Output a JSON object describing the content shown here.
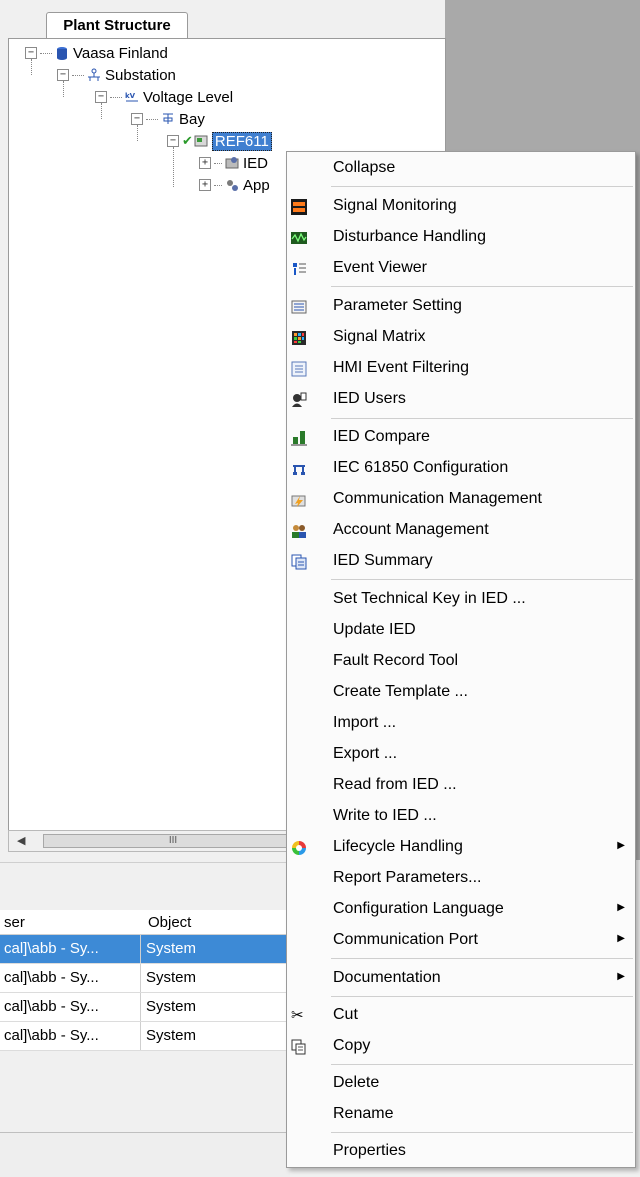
{
  "tab": {
    "title": "Plant Structure"
  },
  "tree": {
    "root": "Vaasa Finland",
    "substation": "Substation",
    "voltage_level": "Voltage Level",
    "bay": "Bay",
    "ied": "REF611",
    "child_ied": "IED",
    "child_app": "App"
  },
  "scrollbar": {
    "thumb_grip": "III"
  },
  "grid": {
    "col_user": "ser",
    "col_object": "Object",
    "rows": [
      {
        "user": "cal]\\abb - Sy...",
        "object": "System"
      },
      {
        "user": "cal]\\abb - Sy...",
        "object": "System"
      },
      {
        "user": "cal]\\abb - Sy...",
        "object": "System"
      },
      {
        "user": "cal]\\abb - Sy...",
        "object": "System"
      }
    ]
  },
  "menu": {
    "collapse": "Collapse",
    "signal_monitoring": "Signal Monitoring",
    "disturbance_handling": "Disturbance Handling",
    "event_viewer": "Event Viewer",
    "parameter_setting": "Parameter Setting",
    "signal_matrix": "Signal Matrix",
    "hmi_event_filtering": "HMI Event Filtering",
    "ied_users": "IED Users",
    "ied_compare": "IED Compare",
    "iec_61850": "IEC 61850 Configuration",
    "communication_management": "Communication Management",
    "account_management": "Account Management",
    "ied_summary": "IED Summary",
    "set_technical_key": "Set Technical Key in IED ...",
    "update_ied": "Update IED",
    "fault_record_tool": "Fault Record Tool",
    "create_template": "Create Template ...",
    "import": "Import ...",
    "export": "Export ...",
    "read_from_ied": "Read from IED ...",
    "write_to_ied": "Write to IED ...",
    "lifecycle_handling": "Lifecycle Handling",
    "report_parameters": "Report Parameters...",
    "configuration_language": "Configuration Language",
    "communication_port": "Communication Port",
    "documentation": "Documentation",
    "cut": "Cut",
    "copy": "Copy",
    "delete": "Delete",
    "rename": "Rename",
    "properties": "Properties"
  }
}
